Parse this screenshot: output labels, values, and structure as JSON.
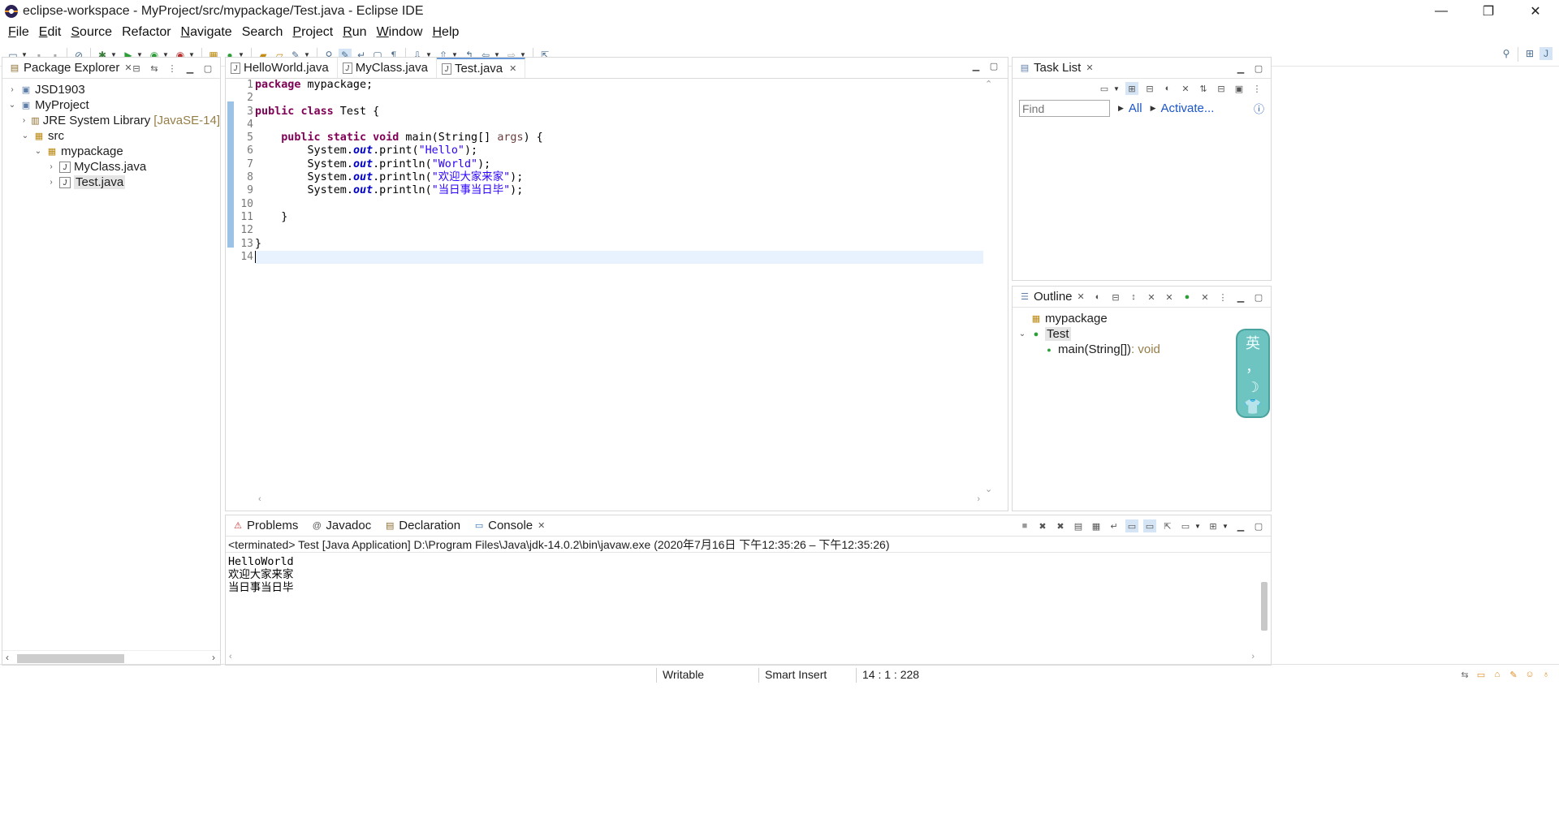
{
  "window": {
    "title": "eclipse-workspace - MyProject/src/mypackage/Test.java - Eclipse IDE",
    "minimize": "—",
    "restore": "❐",
    "close": "✕"
  },
  "menu": [
    {
      "mn": "F",
      "rest": "ile"
    },
    {
      "mn": "E",
      "rest": "dit"
    },
    {
      "mn": "S",
      "rest": "ource"
    },
    {
      "mn": "",
      "rest": "Refactor"
    },
    {
      "mn": "N",
      "rest": "avigate"
    },
    {
      "mn": "",
      "rest": "Search"
    },
    {
      "mn": "P",
      "rest": "roject"
    },
    {
      "mn": "R",
      "rest": "un"
    },
    {
      "mn": "W",
      "rest": "indow"
    },
    {
      "mn": "H",
      "rest": "elp"
    }
  ],
  "package_explorer": {
    "title": "Package Explorer",
    "tree": {
      "jsd": "JSD1903",
      "project": "MyProject",
      "jre": "JRE System Library",
      "jre_version": "[JavaSE-14]",
      "src": "src",
      "package": "mypackage",
      "file1": "MyClass.java",
      "file2": "Test.java"
    }
  },
  "editor": {
    "tabs": [
      "HelloWorld.java",
      "MyClass.java",
      "Test.java"
    ],
    "active_tab": "Test.java",
    "line_numbers": [
      "1",
      "2",
      "3",
      "4",
      "5",
      "6",
      "7",
      "8",
      "9",
      "10",
      "11",
      "12",
      "13",
      "14"
    ],
    "code": {
      "l1_kw": "package",
      "l1_rest": " mypackage;",
      "l3_kw1": "public",
      "l3_kw2": "class",
      "l3_rest": " Test {",
      "l5_kw1": "public",
      "l5_kw2": "static",
      "l5_kw3": "void",
      "l5_mid": " main(String[] ",
      "l5_par": "args",
      "l5_end": ") {",
      "sys": "System.",
      "out": "out",
      "l6_call": ".print(",
      "l6_str": "\"Hello\"",
      "l7_call": ".println(",
      "l7_str": "\"World\"",
      "l8_call": ".println(",
      "l8_str": "\"欢迎大家来家\"",
      "l9_call": ".println(",
      "l9_str": "\"当日事当日毕\"",
      "end_call": ");",
      "l11": "    }",
      "l13": "}"
    }
  },
  "task_list": {
    "title": "Task List",
    "find_placeholder": "Find",
    "all": "All",
    "activate": "Activate..."
  },
  "outline": {
    "title": "Outline",
    "package": "mypackage",
    "class": "Test",
    "method": "main(String[])",
    "method_type": " : void"
  },
  "ime": {
    "lang": "英",
    "punct": "，",
    "moon": "☽",
    "shirt": "👕"
  },
  "bottom_tabs": [
    "Problems",
    "Javadoc",
    "Declaration",
    "Console"
  ],
  "console": {
    "status": "<terminated> Test [Java Application] D:\\Program Files\\Java\\jdk-14.0.2\\bin\\javaw.exe  (2020年7月16日 下午12:35:26 – 下午12:35:26)",
    "output": [
      "HelloWorld",
      "欢迎大家来家",
      "当日事当日毕"
    ]
  },
  "statusbar": {
    "writable": "Writable",
    "insert_mode": "Smart Insert",
    "position": "14 : 1 : 228"
  }
}
